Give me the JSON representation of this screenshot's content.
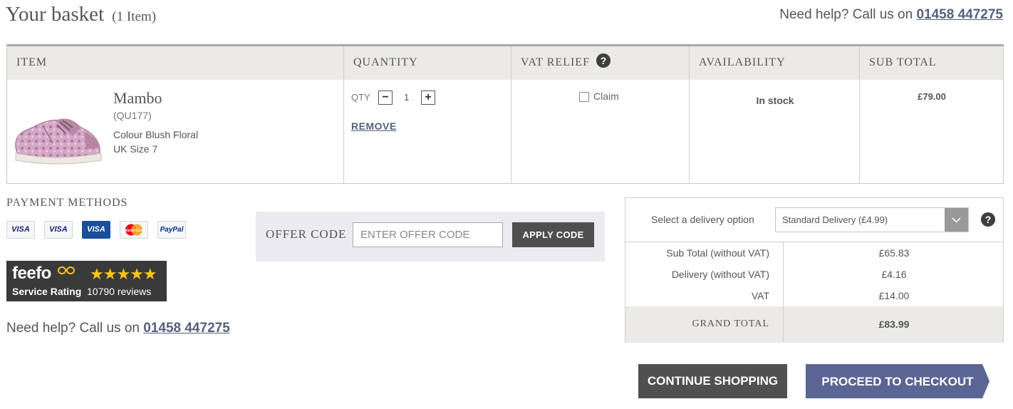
{
  "header": {
    "title": "Your basket",
    "item_count": "(1 Item)",
    "help_prefix": "Need help? Call us on",
    "phone": "01458 447275"
  },
  "table": {
    "columns": [
      "ITEM",
      "QUANTITY",
      "VAT RELIEF",
      "AVAILABILITY",
      "SUB TOTAL"
    ],
    "vat_help_icon": "help-circle-icon"
  },
  "item": {
    "name": "Mambo",
    "code": "(QU177)",
    "colour": "Colour Blush Floral",
    "size": "UK Size 7",
    "qty_label": "QTY",
    "quantity": "1",
    "decrement_symbol": "−",
    "increment_symbol": "+",
    "remove_label": "REMOVE",
    "claim_label": "Claim",
    "availability": "In stock",
    "subtotal": "£79.00"
  },
  "payment": {
    "title": "PAYMENT METHODS",
    "cards": [
      {
        "label": "VISA",
        "color": "#1a1f71"
      },
      {
        "label": "VISA",
        "color": "#1a1f71"
      },
      {
        "label": "VISA",
        "color": "#ffffff"
      },
      {
        "label": "MasterCard",
        "color": "#eb001b"
      },
      {
        "label": "PayPal",
        "color": "#003087"
      }
    ]
  },
  "feefo": {
    "logo": "feefo",
    "stars": "★★★★★",
    "rating_label": "Service Rating",
    "reviews": "10790 reviews"
  },
  "help_bottom": {
    "prefix": "Need help? Call us on",
    "phone": "01458 447275"
  },
  "offer": {
    "label": "OFFER CODE",
    "placeholder": "ENTER OFFER CODE",
    "apply_label": "APPLY CODE"
  },
  "summary": {
    "delivery_label": "Select a delivery option",
    "delivery_selected": "Standard Delivery (£4.99)",
    "rows": [
      {
        "label": "Sub Total (without VAT)",
        "value": "£65.83"
      },
      {
        "label": "Delivery (without VAT)",
        "value": "£4.16"
      },
      {
        "label": "VAT",
        "value": "£14.00"
      }
    ],
    "grand_total_label": "GRAND TOTAL",
    "grand_total_value": "£83.99"
  },
  "actions": {
    "continue_label": "CONTINUE SHOPPING",
    "checkout_label": "PROCEED TO CHECKOUT"
  },
  "colors": {
    "link": "#55607e",
    "checkout_button": "#5a6594",
    "dark_button": "#505050",
    "header_bg": "#ebeae6"
  }
}
